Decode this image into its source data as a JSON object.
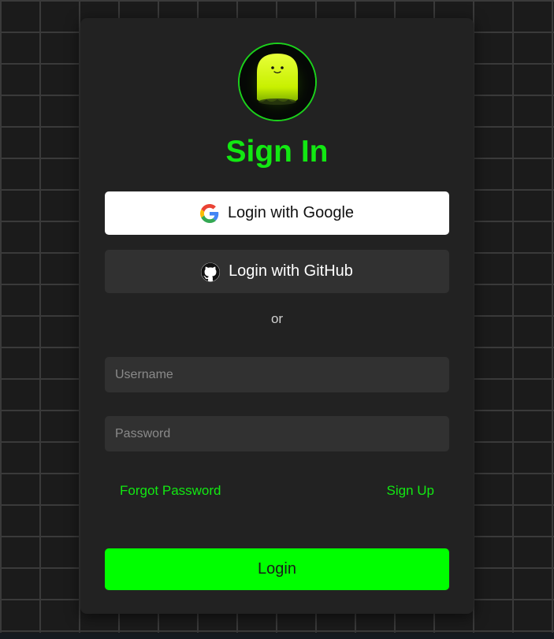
{
  "title": "Sign In",
  "social": {
    "google_label": "Login with Google",
    "github_label": "Login with GitHub"
  },
  "divider_text": "or",
  "form": {
    "username_placeholder": "Username",
    "username_value": "",
    "password_placeholder": "Password",
    "password_value": ""
  },
  "links": {
    "forgot_password": "Forgot Password",
    "sign_up": "Sign Up"
  },
  "login_button_label": "Login",
  "colors": {
    "accent": "#12e812",
    "login_button_bg": "#00ff00",
    "card_bg": "#222222",
    "button_dark_bg": "#313131"
  },
  "icons": {
    "avatar": "ghost-mascot-icon",
    "google": "google-icon",
    "github": "github-icon"
  }
}
